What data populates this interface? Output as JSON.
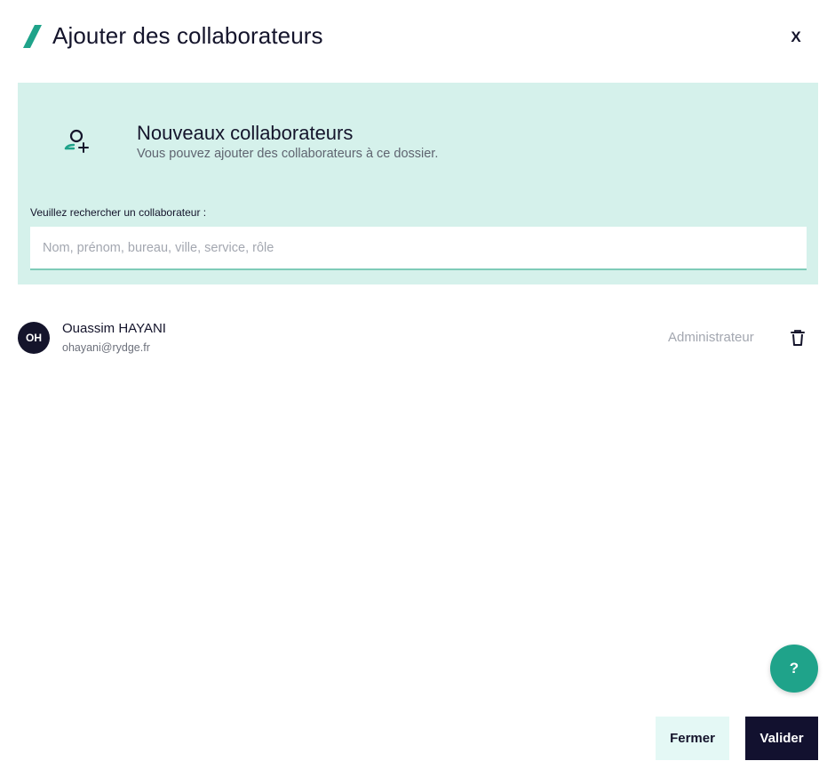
{
  "modal": {
    "title": "Ajouter des collaborateurs",
    "close_label": "X",
    "title_icon": "slash-icon"
  },
  "panel": {
    "icon": "user-add-icon",
    "title": "Nouveaux collaborateurs",
    "subtitle": "Vous pouvez ajouter des collaborateurs à ce dossier.",
    "search_label": "Veuillez rechercher un collaborateur :",
    "search_placeholder": "Nom, prénom, bureau, ville, service, rôle",
    "search_value": ""
  },
  "collaborators": [
    {
      "initials": "OH",
      "name": "Ouassim HAYANI",
      "email": "ohayani@rydge.fr",
      "role": "Administrateur",
      "delete_icon": "trash-icon"
    }
  ],
  "help": {
    "label": "?",
    "icon": "question-icon"
  },
  "footer": {
    "close_label": "Fermer",
    "submit_label": "Valider"
  },
  "colors": {
    "accent": "#1fa38a",
    "panel_bg": "#d5f1eb",
    "dark": "#12112f",
    "secondary_btn_bg": "#e4f8f5"
  }
}
